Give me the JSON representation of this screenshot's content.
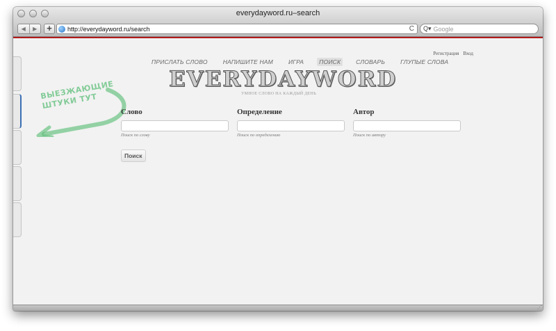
{
  "window": {
    "title": "everydayword.ru–search"
  },
  "toolbar": {
    "back_label": "◀",
    "forward_label": "▶",
    "add_label": "+",
    "url": "http://everydayword.ru/search",
    "reload_label": "C",
    "search_placeholder": "Google"
  },
  "header": {
    "auth_links": [
      "Регистрация",
      "Вход"
    ],
    "menu": [
      {
        "label": "ПРИСЛАТЬ СЛОВО",
        "active": false
      },
      {
        "label": "НАПИШИТЕ НАМ",
        "active": false
      },
      {
        "label": "ИГРА",
        "active": false
      },
      {
        "label": "ПОИСК",
        "active": true
      },
      {
        "label": "СЛОВАРЬ",
        "active": false
      },
      {
        "label": "ГЛУПЫЕ СЛОВА",
        "active": false
      }
    ],
    "logo": "EVERYDAYWORD",
    "tagline": "УМНОЕ СЛОВО НА КАЖДЫЙ ДЕНЬ"
  },
  "stamp": {
    "line1": "ВЫЕЗЖАЮЩИЕ",
    "line2": "ШТУКИ ТУТ"
  },
  "form": {
    "fields": [
      {
        "label": "Слово",
        "value": "",
        "hint": "Поиск по слову"
      },
      {
        "label": "Определение",
        "value": "",
        "hint": "Поиск по определению"
      },
      {
        "label": "Автор",
        "value": "",
        "hint": "Поиск по автору"
      }
    ],
    "submit_label": "Поиск"
  },
  "colors": {
    "accent_red": "#b21b1b",
    "stamp_green": "#5fbf7a",
    "side_tab_active": "#3b6fb3"
  }
}
